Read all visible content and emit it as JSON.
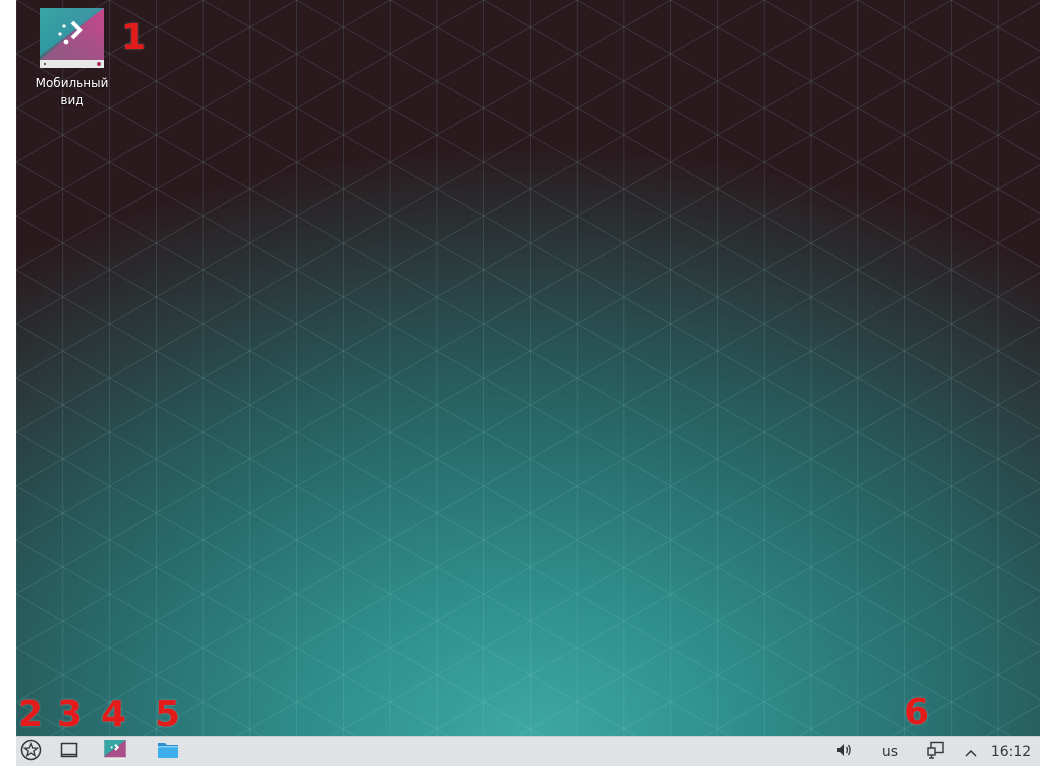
{
  "desktop": {
    "icons": [
      {
        "label": "Мобильный\nвид",
        "icon": "mobile-view-app-icon"
      }
    ]
  },
  "markers": [
    "1",
    "2",
    "3",
    "4",
    "5",
    "6"
  ],
  "taskbar": {
    "launcher_icon": "application-launcher-icon",
    "show_desktop_icon": "show-desktop-icon",
    "tasks": [
      {
        "icon": "mobile-view-app-icon"
      },
      {
        "icon": "folder-icon"
      }
    ],
    "tray": {
      "volume_icon": "volume-icon",
      "keyboard_layout": "us",
      "network_icon": "network-icon",
      "expand_icon": "chevron-up-icon",
      "clock": "16:12"
    }
  },
  "colors": {
    "marker": "#e31b1b",
    "taskbar_bg": "#dfe3e6",
    "folder": "#3daee9"
  }
}
